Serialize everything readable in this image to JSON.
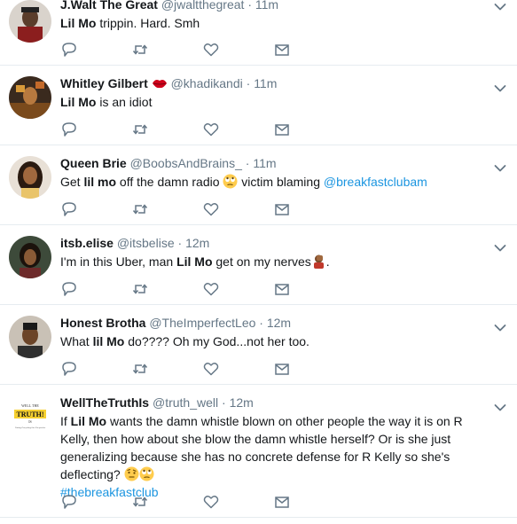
{
  "tweets": [
    {
      "name": "J.Walt The Great",
      "handle": "@jwaltthegreat",
      "separator": "·",
      "time": "11m",
      "text_parts": [
        {
          "b": "Lil Mo"
        },
        {
          "t": " trippin. Hard. Smh"
        }
      ]
    },
    {
      "name": "Whitley Gilbert",
      "handle": "@khadikandi",
      "separator": "·",
      "time": "11m",
      "name_emoji": "lips-emoji",
      "text_parts": [
        {
          "b": "Lil Mo"
        },
        {
          "t": " is an idiot"
        }
      ]
    },
    {
      "name": "Queen Brie",
      "handle": "@BoobsAndBrains_",
      "separator": "·",
      "time": "11m",
      "text_parts": [
        {
          "t": "Get "
        },
        {
          "b": "lil mo"
        },
        {
          "t": " off the damn radio "
        },
        {
          "e": "rolling-eyes-emoji"
        },
        {
          "t": " victim blaming "
        },
        {
          "l": "@breakfastclubam"
        }
      ]
    },
    {
      "name": "itsb.elise",
      "handle": "@itsbelise",
      "separator": "·",
      "time": "12m",
      "text_parts": [
        {
          "t": "I'm in this Uber, man "
        },
        {
          "b": "Lil Mo"
        },
        {
          "t": " get on my nerves"
        },
        {
          "e": "facepalm-emoji"
        },
        {
          "t": "."
        }
      ]
    },
    {
      "name": "Honest Brotha",
      "handle": "@TheImperfectLeo",
      "separator": "·",
      "time": "12m",
      "text_parts": [
        {
          "t": "What "
        },
        {
          "b": "lil Mo"
        },
        {
          "t": " do???? Oh my God...not her too."
        }
      ]
    },
    {
      "name": "WellTheTruthIs",
      "handle": "@truth_well",
      "separator": "·",
      "time": "12m",
      "logo_text": [
        "WELL THE",
        "TRUTH!",
        "IS",
        "Putting Everything Into Perspective"
      ],
      "text_parts": [
        {
          "t": "If "
        },
        {
          "b": "Lil Mo"
        },
        {
          "t": " wants the damn whistle blown on other people the way it is on R Kelly, then how about she blow the damn whistle herself? Or is she just generalizing because she has no concrete defense for R Kelly so she's deflecting? "
        },
        {
          "e": "raised-eyebrow-emoji"
        },
        {
          "e": "rolling-eyes-emoji"
        },
        {
          "br": true
        },
        {
          "l": "#thebreakfastclub"
        }
      ]
    }
  ],
  "colors": {
    "name": "#14171a",
    "meta": "#657786",
    "link": "#1b95e0",
    "border": "#e6ecf0",
    "icon": "#657786"
  }
}
